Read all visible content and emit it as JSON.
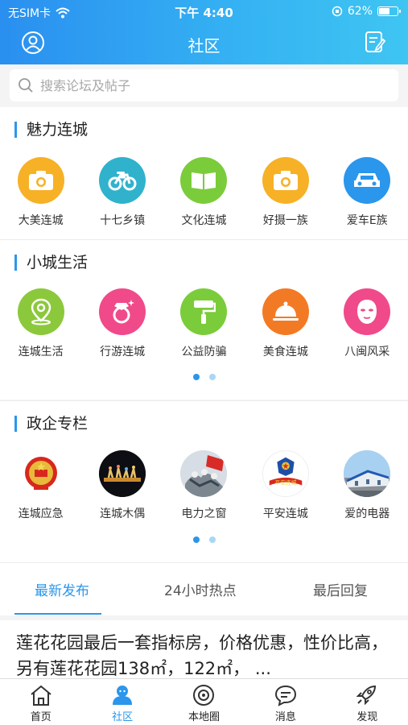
{
  "status_bar": {
    "carrier": "无SIM卡",
    "time": "下午 4:40",
    "battery": "62%",
    "battery_level": 0.62
  },
  "header": {
    "title": "社区",
    "user_icon": "user-circle-icon",
    "edit_icon": "edit-note-icon"
  },
  "search": {
    "placeholder": "搜索论坛及帖子"
  },
  "section1": {
    "title": "魅力连城",
    "items": [
      {
        "label": "大美连城",
        "icon": "camera-icon",
        "color": "#f7b126"
      },
      {
        "label": "十七乡镇",
        "icon": "bicycle-icon",
        "color": "#30b2cd"
      },
      {
        "label": "文化连城",
        "icon": "book-icon",
        "color": "#7bcc3a"
      },
      {
        "label": "好摄一族",
        "icon": "camera-icon",
        "color": "#f7b126"
      },
      {
        "label": "爱车E族",
        "icon": "car-icon",
        "color": "#2a96ec"
      }
    ]
  },
  "section2": {
    "title": "小城生活",
    "items": [
      {
        "label": "连城生活",
        "icon": "location-pin-icon",
        "color": "#8cc83c"
      },
      {
        "label": "行游连城",
        "icon": "ring-icon",
        "color": "#f04a8a"
      },
      {
        "label": "公益防骗",
        "icon": "paint-roller-icon",
        "color": "#7bcc3a"
      },
      {
        "label": "美食连城",
        "icon": "food-cloche-icon",
        "color": "#f37a24"
      },
      {
        "label": "八闽风采",
        "icon": "face-mask-icon",
        "color": "#f04a8a"
      }
    ]
  },
  "section3": {
    "title": "政企专栏",
    "items": [
      {
        "label": "连城应急",
        "icon": "national-emblem-image"
      },
      {
        "label": "连城木偶",
        "icon": "puppet-stage-image"
      },
      {
        "label": "电力之窗",
        "icon": "power-workers-image"
      },
      {
        "label": "平安连城",
        "icon": "police-emblem-image"
      },
      {
        "label": "爱的电器",
        "icon": "store-building-image"
      }
    ]
  },
  "tabs": [
    {
      "label": "最新发布",
      "active": true
    },
    {
      "label": "24小时热点",
      "active": false
    },
    {
      "label": "最后回复",
      "active": false
    }
  ],
  "post": {
    "text": "莲花花园最后一套指标房，价格优惠，性价比高，另有莲花花园138㎡，122㎡， ..."
  },
  "tabbar": [
    {
      "label": "首页",
      "icon": "home-icon",
      "active": false
    },
    {
      "label": "社区",
      "icon": "community-icon",
      "active": true
    },
    {
      "label": "本地圈",
      "icon": "local-circle-icon",
      "active": false
    },
    {
      "label": "消息",
      "icon": "message-icon",
      "active": false
    },
    {
      "label": "发现",
      "icon": "rocket-icon",
      "active": false
    }
  ],
  "colors": {
    "accent": "#2a96ec",
    "header_start": "#2a8ff0",
    "header_end": "#3fc5f2"
  }
}
